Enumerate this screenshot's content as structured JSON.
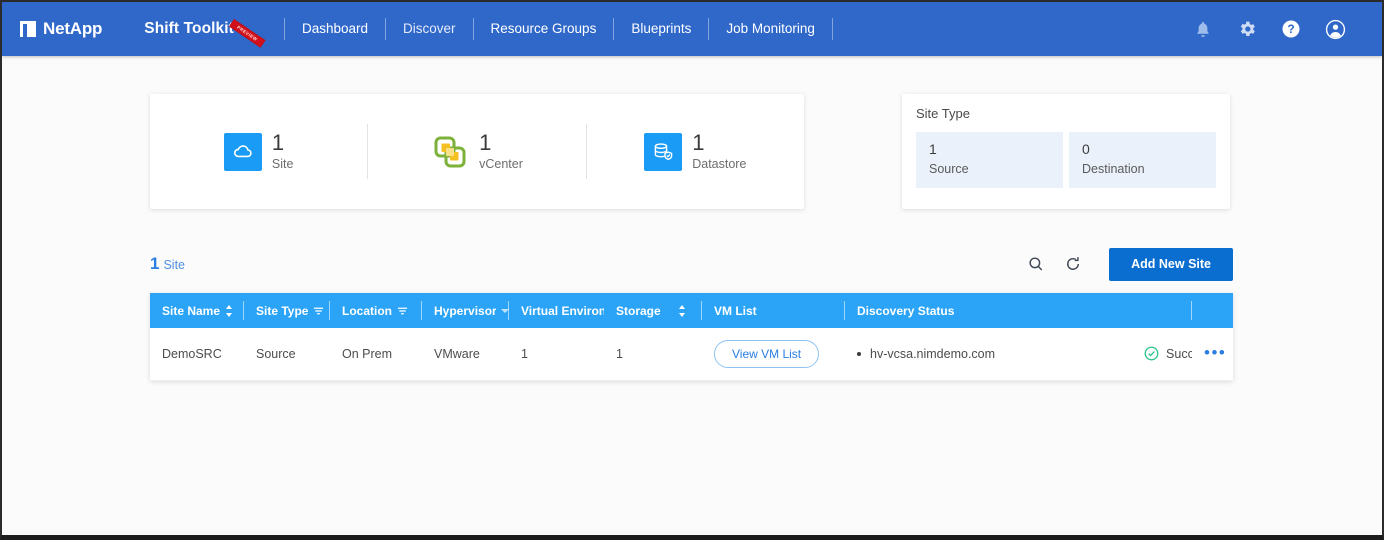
{
  "navbar": {
    "logo_text": "NetApp",
    "app_title": "Shift Toolkit",
    "ribbon_label": "PREVIEW",
    "links": [
      {
        "label": "Dashboard",
        "active": true
      },
      {
        "label": "Discover",
        "active": false
      },
      {
        "label": "Resource Groups",
        "active": true
      },
      {
        "label": "Blueprints",
        "active": true
      },
      {
        "label": "Job Monitoring",
        "active": true
      }
    ],
    "icons": [
      "bell-icon",
      "gear-icon",
      "help-icon",
      "user-account-icon"
    ]
  },
  "stats": {
    "items": [
      {
        "icon": "cloud-icon",
        "value": "1",
        "label": "Site"
      },
      {
        "icon": "vcenter-icon",
        "value": "1",
        "label": "vCenter"
      },
      {
        "icon": "datastore-icon",
        "value": "1",
        "label": "Datastore"
      }
    ]
  },
  "site_type_card": {
    "title": "Site Type",
    "boxes": [
      {
        "value": "1",
        "label": "Source"
      },
      {
        "value": "0",
        "label": "Destination"
      }
    ]
  },
  "toolbar": {
    "count": "1",
    "count_label": "Site",
    "search_icon": "search-icon",
    "refresh_icon": "refresh-icon",
    "add_button": "Add New Site"
  },
  "table": {
    "columns": [
      {
        "label": "Site Name",
        "control": "sort"
      },
      {
        "label": "Site Type",
        "control": "filter"
      },
      {
        "label": "Location",
        "control": "filter"
      },
      {
        "label": "Hypervisor",
        "control": "caret"
      },
      {
        "label": "Virtual Environ",
        "control": "none"
      },
      {
        "label": "Storage",
        "control": "sort"
      },
      {
        "label": "VM List",
        "control": "none"
      },
      {
        "label": "Discovery Status",
        "control": "none"
      },
      {
        "label": "",
        "control": "none"
      }
    ],
    "rows": [
      {
        "site_name": "DemoSRC",
        "site_type": "Source",
        "location": "On Prem",
        "hypervisor": "VMware",
        "virtual_environment": "1",
        "storage": "1",
        "vm_list_button": "View VM List",
        "discovery_host": "hv-vcsa.nimdemo.com",
        "status": "Success",
        "actions": "•••"
      }
    ]
  },
  "colors": {
    "nav_blue": "#3068c9",
    "table_header_blue": "#2ba4f7",
    "primary_button": "#0a6ed1",
    "link_blue": "#2a7de1",
    "success_green": "#2bc48a",
    "ribbon_red": "#d0101b"
  }
}
